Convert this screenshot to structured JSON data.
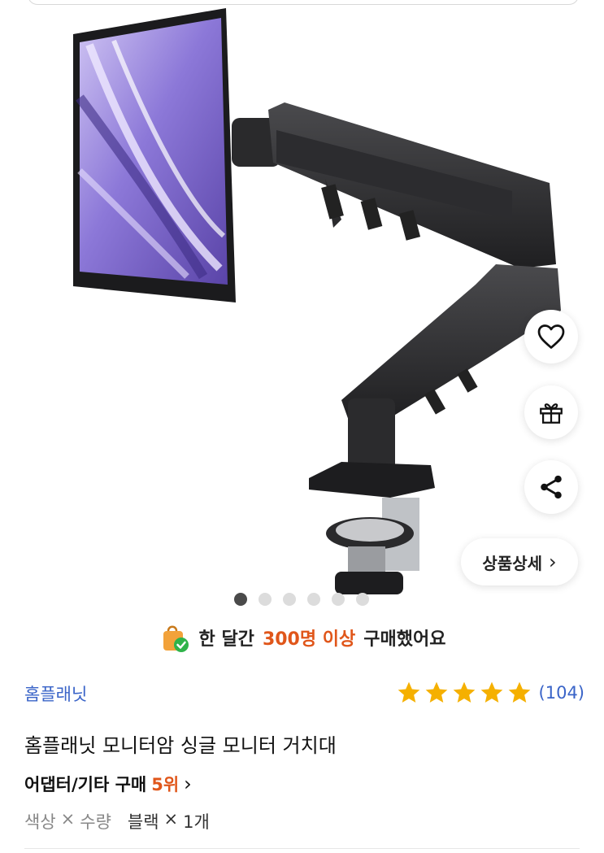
{
  "product": {
    "image_alt": "모니터암 제품 이미지",
    "carousel": {
      "count": 6,
      "active_index": 0
    }
  },
  "actions": {
    "like_icon": "heart-outline-icon",
    "gift_icon": "gift-icon",
    "share_icon": "share-icon",
    "detail_label": "상품상세",
    "detail_chevron": "›"
  },
  "banner": {
    "prefix": "한 달간",
    "count": "300명 이상",
    "suffix": "구매했어요",
    "icon": "shopping-bag-check-icon"
  },
  "store": {
    "name": "홈플래닛",
    "rating": 5,
    "review_count": "(104)",
    "star_color": "#f5b000"
  },
  "title": "홈플래닛 모니터암 싱글 모니터 거치대",
  "rank": {
    "category": "어댑터/기타 구매",
    "position": "5위",
    "chevron": "›"
  },
  "options": {
    "label_color": "색상",
    "label_times": "×",
    "label_qty": "수량",
    "value_color": "블랙",
    "value_times": "×",
    "value_qty": "1개"
  },
  "colors": {
    "accent": "#e0561a",
    "link": "#3a64c8"
  }
}
